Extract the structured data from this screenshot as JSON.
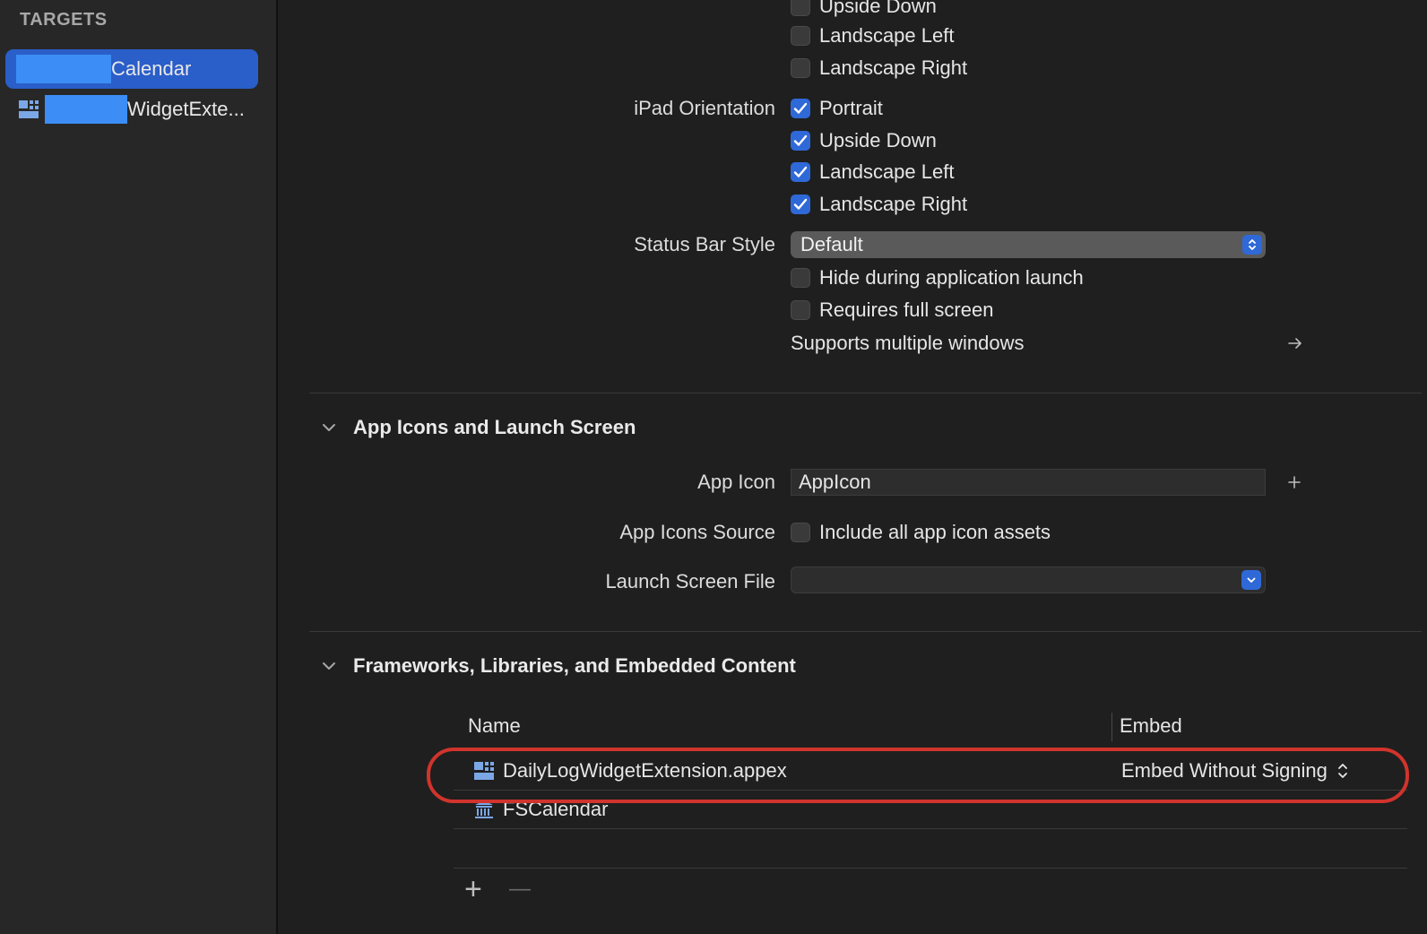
{
  "sidebar": {
    "header": "TARGETS",
    "items": [
      {
        "label": "Calendar",
        "selected": true,
        "icon": "app-target-icon"
      },
      {
        "label": "WidgetExte...",
        "selected": false,
        "icon": "widget-extension-icon"
      }
    ]
  },
  "deployment": {
    "iphone_orientation_partial": [
      {
        "label": "Upside Down",
        "checked": false
      },
      {
        "label": "Landscape Left",
        "checked": false
      },
      {
        "label": "Landscape Right",
        "checked": false
      }
    ],
    "ipad_orientation_label": "iPad Orientation",
    "ipad_orientation": [
      {
        "label": "Portrait",
        "checked": true
      },
      {
        "label": "Upside Down",
        "checked": true
      },
      {
        "label": "Landscape Left",
        "checked": true
      },
      {
        "label": "Landscape Right",
        "checked": true
      }
    ],
    "status_bar_style_label": "Status Bar Style",
    "status_bar_style_value": "Default",
    "hide_during_launch": {
      "label": "Hide during application launch",
      "checked": false
    },
    "requires_full_screen": {
      "label": "Requires full screen",
      "checked": false
    },
    "supports_multiple_windows": "Supports multiple windows"
  },
  "app_icons": {
    "section_title": "App Icons and Launch Screen",
    "app_icon_label": "App Icon",
    "app_icon_value": "AppIcon",
    "app_icons_source_label": "App Icons Source",
    "include_all_assets": {
      "label": "Include all app icon assets",
      "checked": false
    },
    "launch_screen_label": "Launch Screen File",
    "launch_screen_value": ""
  },
  "frameworks": {
    "section_title": "Frameworks, Libraries, and Embedded Content",
    "columns": {
      "name": "Name",
      "embed": "Embed"
    },
    "rows": [
      {
        "name": "DailyLogWidgetExtension.appex",
        "embed": "Embed Without Signing",
        "icon": "widget-extension-icon",
        "highlighted": true
      },
      {
        "name": "FSCalendar",
        "embed": "",
        "icon": "framework-library-icon",
        "highlighted": false
      }
    ],
    "add_symbol": "+",
    "remove_symbol": "—"
  },
  "colors": {
    "accent": "#2f69d8",
    "selection": "#2a5ec9",
    "highlight_ring": "#d0342c",
    "redaction": "#3c8df5"
  }
}
